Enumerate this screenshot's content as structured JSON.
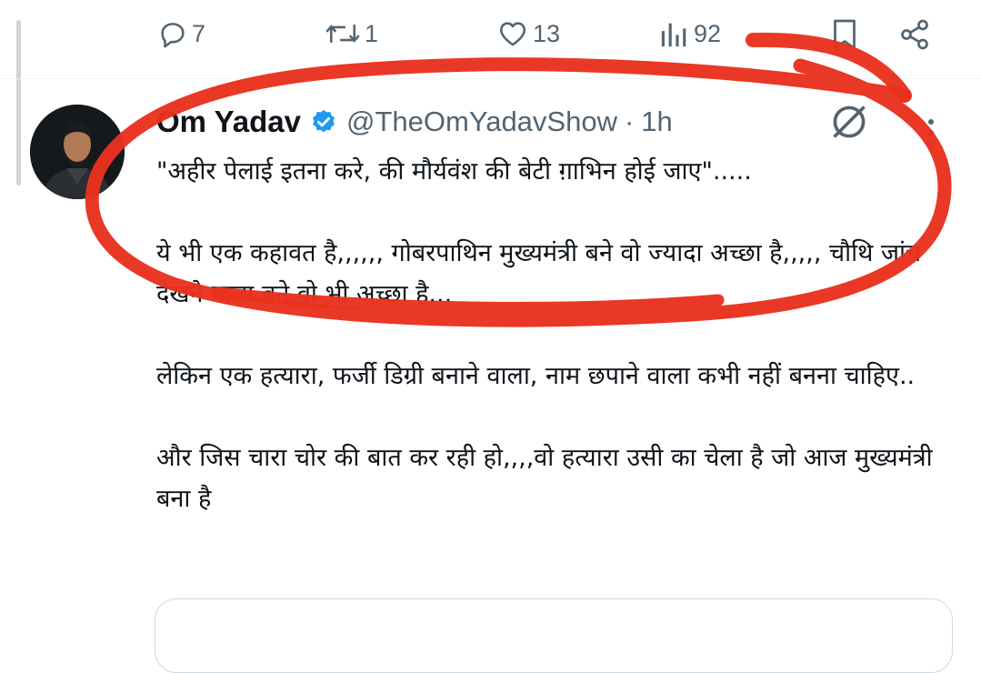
{
  "actions": {
    "reply_count": "7",
    "retweet_count": "1",
    "like_count": "13",
    "views_count": "92"
  },
  "tweet": {
    "author_name": "Om Yadav",
    "handle": "@TheOmYadavShow",
    "separator": "·",
    "time": "1h",
    "text": "\"अहीर पेलाई इतना करे, की मौर्यवंश की बेटी ग़ाभिन होई जाए\".....\n\nये भी एक कहावत है,,,,,, गोबरपाथिन मुख्यमंत्री बने वो ज्यादा अच्छा है,,,,, चौथि जांच देखने वाला बने वो भी अच्छा है...\n\nलेकिन एक हत्यारा, फर्जी डिग्री बनाने वाला, नाम छपाने वाला कभी नहीं बनना चाहिए..\n\nऔर जिस चारा चोर की बात कर रही हो,,,,वो हत्यारा उसी का चेला है जो आज मुख्यमंत्री बना है"
  },
  "icons": {
    "reply": "reply-icon",
    "retweet": "retweet-icon",
    "like": "heart-icon",
    "views": "views-chart-icon",
    "bookmark": "bookmark-icon",
    "share": "share-icon",
    "verified": "verified-badge-icon",
    "grok": "grok-icon",
    "more": "more-dots-icon"
  },
  "colors": {
    "icon_gray": "#536471",
    "verified_blue": "#1d9bf0",
    "annotation_red": "#e8321e"
  }
}
